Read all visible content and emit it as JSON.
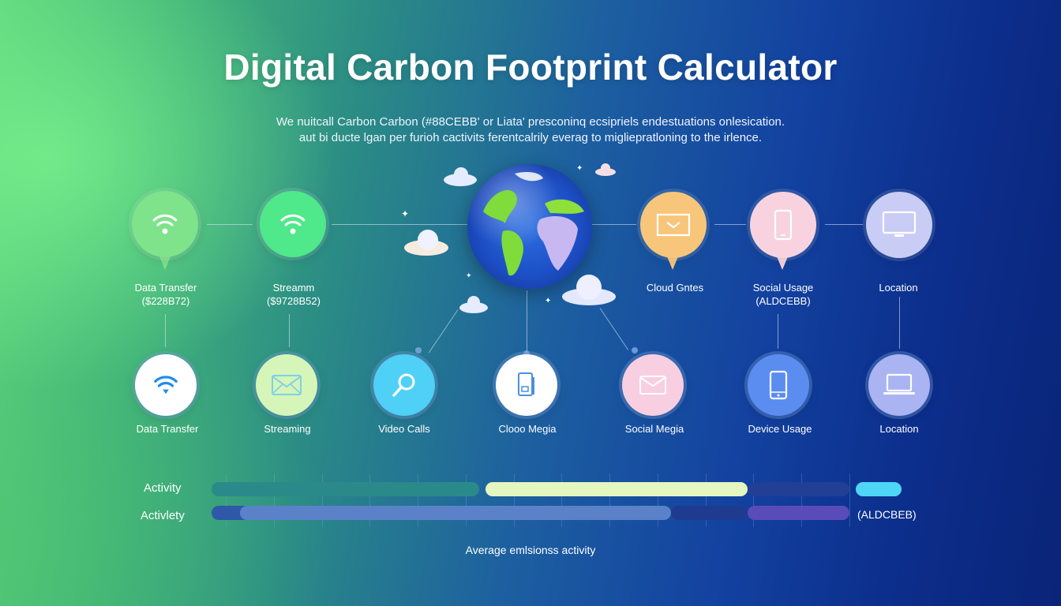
{
  "header": {
    "title": "Digital Carbon Footprint Calculator",
    "subtitle_lines": [
      "We nuitcall Carbon Carbon (#88CEBB' or Liata' presconinq ecsipriels endestuations onlesication.",
      "aut bi ducte lgan per furioh cactivits ferentcalrily everag to migliepratloning to the irlence."
    ]
  },
  "top_nodes": [
    {
      "label": "Data Transfer",
      "value": "($228B72)",
      "icon": "wifi-icon",
      "color": "#7ee38a"
    },
    {
      "label": "Streamm",
      "value": "($9728B52)",
      "icon": "wifi-icon",
      "color": "#4fe88a"
    },
    {
      "label": "Cloud Gntes",
      "value": "",
      "icon": "mail-icon",
      "color": "#f7c67a"
    },
    {
      "label": "Social Usage",
      "value": "(ALDCEBB)",
      "icon": "phone-icon",
      "color": "#f8d3df"
    },
    {
      "label": "Location",
      "value": "",
      "icon": "monitor-icon",
      "color": "#c9cdf5"
    }
  ],
  "bottom_nodes": [
    {
      "label": "Data Transfer",
      "icon": "wifi-icon",
      "color": "#ffffff",
      "icon_color": "#1e8cf0"
    },
    {
      "label": "Streaming",
      "icon": "mail-icon",
      "color": "#d6f5b8",
      "icon_color": "#7fd0e8"
    },
    {
      "label": "Video Calls",
      "icon": "search-icon",
      "color": "#4fd0f7",
      "icon_color": "#ffffff"
    },
    {
      "label": "Clooo Megia",
      "icon": "tablet-icon",
      "color": "#ffffff",
      "icon_color": "#4a8fe0"
    },
    {
      "label": "Social Megia",
      "icon": "mail-icon",
      "color": "#f8cfe0",
      "icon_color": "#ffffff"
    },
    {
      "label": "Device Usage",
      "icon": "phone-icon",
      "color": "#5b8df0",
      "icon_color": "#ffffff"
    },
    {
      "label": "Location",
      "icon": "laptop-icon",
      "color": "#aab4f2",
      "icon_color": "#ffffff"
    }
  ],
  "center": {
    "icon": "globe-icon"
  },
  "chart_data": {
    "type": "bar",
    "title": "",
    "xlabel": "Average emlsionss activity",
    "ylabel": "",
    "categories": [
      "Activity",
      "Activlety"
    ],
    "xlim": [
      0,
      1
    ],
    "series": [
      {
        "row": "Activity",
        "segments": [
          {
            "start": 0.0,
            "end": 0.42,
            "color": "#2a8a8a"
          },
          {
            "start": 0.43,
            "end": 0.84,
            "color": "#e4f7c0"
          },
          {
            "start": 0.84,
            "end": 1.0,
            "color": "#213f94"
          }
        ]
      },
      {
        "row": "Activlety",
        "segments": [
          {
            "start": 0.0,
            "end": 0.13,
            "color": "#2e58a8"
          },
          {
            "start": 0.045,
            "end": 0.72,
            "color": "#5b82c8"
          },
          {
            "start": 0.72,
            "end": 0.84,
            "color": "#1e3b90"
          },
          {
            "start": 0.84,
            "end": 1.0,
            "color": "#5a4cb8"
          }
        ]
      }
    ],
    "extra_bar": {
      "row": "Activity",
      "color": "#4fd6f7"
    },
    "right_note": "(ALDCBEB)",
    "grid": true
  }
}
